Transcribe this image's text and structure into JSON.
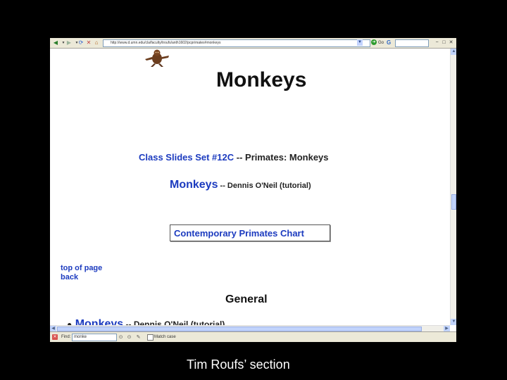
{
  "browser": {
    "address_url": "http://www.d.umn.edu/cla/faculty/troufs/anth1602/pcprimates#monkeys",
    "go_label": "Go",
    "g_label": "G"
  },
  "page": {
    "title": "Monkeys",
    "class_slides_link": "Class Slides Set #12C",
    "class_slides_rest": " -- Primates: Monkeys",
    "monkeys_link": "Monkeys",
    "monkeys_rest": " -- Dennis O'Neil (tutorial)",
    "chart_link": "Contemporary Primates Chart",
    "top_of_page": "top of page",
    "back": "back",
    "general_heading": "General",
    "general_item_link": "Monkeys",
    "general_item_rest": " -- Dennis O'Neil (tutorial)"
  },
  "findbar": {
    "label": "Find:",
    "value": "monke",
    "match_case_label": "Match case"
  },
  "caption": "Tim Roufs’ section"
}
